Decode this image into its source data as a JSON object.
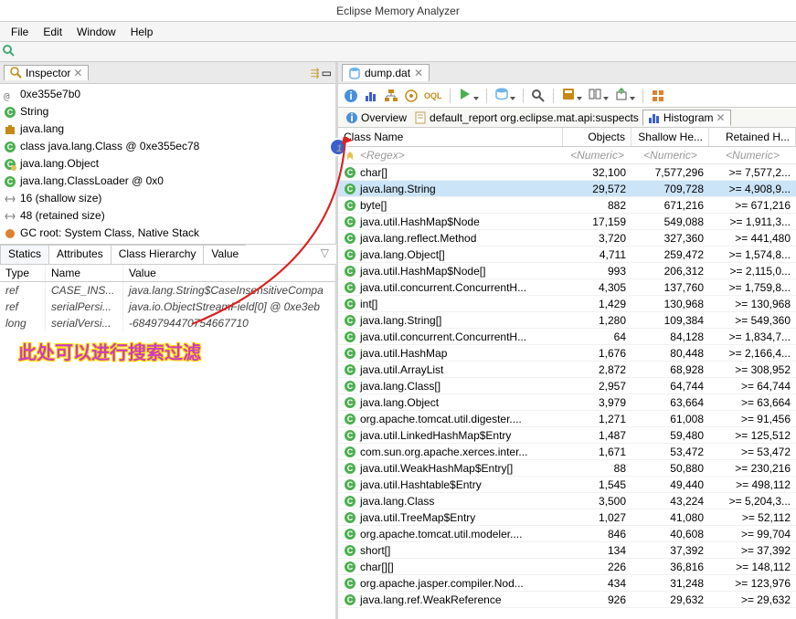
{
  "app_title": "Eclipse Memory Analyzer",
  "menus": [
    "File",
    "Edit",
    "Window",
    "Help"
  ],
  "inspector": {
    "tab": "Inspector",
    "rows": [
      {
        "icon": "at",
        "text": "0xe355e7b0"
      },
      {
        "icon": "class",
        "text": "String"
      },
      {
        "icon": "package",
        "text": "java.lang"
      },
      {
        "icon": "class",
        "text": "class java.lang.Class @ 0xe355ec78"
      },
      {
        "icon": "class-deco",
        "text": "java.lang.Object"
      },
      {
        "icon": "class",
        "text": "java.lang.ClassLoader @ 0x0"
      },
      {
        "icon": "size",
        "text": "16 (shallow size)"
      },
      {
        "icon": "size",
        "text": "48 (retained size)"
      },
      {
        "icon": "gc",
        "text": "GC root: System Class, Native Stack"
      }
    ],
    "subtabs": [
      "Statics",
      "Attributes",
      "Class Hierarchy",
      "Value"
    ],
    "columns": {
      "type": "Type",
      "name": "Name",
      "value": "Value"
    },
    "props": [
      {
        "type": "ref",
        "name": "CASE_INS...",
        "value": "java.lang.String$CaseInsensitiveCompa"
      },
      {
        "type": "ref",
        "name": "serialPersi...",
        "value": "java.io.ObjectStreamField[0] @ 0xe3eb"
      },
      {
        "type": "long",
        "name": "serialVersi...",
        "value": "-6849794470754667710"
      }
    ]
  },
  "annotation": "此处可以进行搜索过滤",
  "editor": {
    "file": "dump.dat"
  },
  "nav": {
    "overview": "Overview",
    "report": "default_report  org.eclipse.mat.api:suspects",
    "histogram": "Histogram"
  },
  "hist": {
    "cols": {
      "cn": "Class Name",
      "ob": "Objects",
      "sh": "Shallow He...",
      "rh": "Retained H..."
    },
    "filter": {
      "cn": "<Regex>",
      "n": "<Numeric>"
    },
    "badge": "1",
    "rows": [
      {
        "cn": "char[]",
        "ob": "32,100",
        "sh": "7,577,296",
        "rh": ">= 7,577,2..."
      },
      {
        "cn": "java.lang.String",
        "ob": "29,572",
        "sh": "709,728",
        "rh": ">= 4,908,9...",
        "sel": true
      },
      {
        "cn": "byte[]",
        "ob": "882",
        "sh": "671,216",
        "rh": ">= 671,216"
      },
      {
        "cn": "java.util.HashMap$Node",
        "ob": "17,159",
        "sh": "549,088",
        "rh": ">= 1,911,3..."
      },
      {
        "cn": "java.lang.reflect.Method",
        "ob": "3,720",
        "sh": "327,360",
        "rh": ">= 441,480"
      },
      {
        "cn": "java.lang.Object[]",
        "ob": "4,711",
        "sh": "259,472",
        "rh": ">= 1,574,8..."
      },
      {
        "cn": "java.util.HashMap$Node[]",
        "ob": "993",
        "sh": "206,312",
        "rh": ">= 2,115,0..."
      },
      {
        "cn": "java.util.concurrent.ConcurrentH...",
        "ob": "4,305",
        "sh": "137,760",
        "rh": ">= 1,759,8..."
      },
      {
        "cn": "int[]",
        "ob": "1,429",
        "sh": "130,968",
        "rh": ">= 130,968"
      },
      {
        "cn": "java.lang.String[]",
        "ob": "1,280",
        "sh": "109,384",
        "rh": ">= 549,360"
      },
      {
        "cn": "java.util.concurrent.ConcurrentH...",
        "ob": "64",
        "sh": "84,128",
        "rh": ">= 1,834,7..."
      },
      {
        "cn": "java.util.HashMap",
        "ob": "1,676",
        "sh": "80,448",
        "rh": ">= 2,166,4..."
      },
      {
        "cn": "java.util.ArrayList",
        "ob": "2,872",
        "sh": "68,928",
        "rh": ">= 308,952"
      },
      {
        "cn": "java.lang.Class[]",
        "ob": "2,957",
        "sh": "64,744",
        "rh": ">= 64,744"
      },
      {
        "cn": "java.lang.Object",
        "ob": "3,979",
        "sh": "63,664",
        "rh": ">= 63,664"
      },
      {
        "cn": "org.apache.tomcat.util.digester....",
        "ob": "1,271",
        "sh": "61,008",
        "rh": ">= 91,456"
      },
      {
        "cn": "java.util.LinkedHashMap$Entry",
        "ob": "1,487",
        "sh": "59,480",
        "rh": ">= 125,512"
      },
      {
        "cn": "com.sun.org.apache.xerces.inter...",
        "ob": "1,671",
        "sh": "53,472",
        "rh": ">= 53,472"
      },
      {
        "cn": "java.util.WeakHashMap$Entry[]",
        "ob": "88",
        "sh": "50,880",
        "rh": ">= 230,216"
      },
      {
        "cn": "java.util.Hashtable$Entry",
        "ob": "1,545",
        "sh": "49,440",
        "rh": ">= 498,112"
      },
      {
        "cn": "java.lang.Class",
        "ob": "3,500",
        "sh": "43,224",
        "rh": ">= 5,204,3..."
      },
      {
        "cn": "java.util.TreeMap$Entry",
        "ob": "1,027",
        "sh": "41,080",
        "rh": ">= 52,112"
      },
      {
        "cn": "org.apache.tomcat.util.modeler....",
        "ob": "846",
        "sh": "40,608",
        "rh": ">= 99,704"
      },
      {
        "cn": "short[]",
        "ob": "134",
        "sh": "37,392",
        "rh": ">= 37,392"
      },
      {
        "cn": "char[][]",
        "ob": "226",
        "sh": "36,816",
        "rh": ">= 148,112"
      },
      {
        "cn": "org.apache.jasper.compiler.Nod...",
        "ob": "434",
        "sh": "31,248",
        "rh": ">= 123,976"
      },
      {
        "cn": "java.lang.ref.WeakReference",
        "ob": "926",
        "sh": "29,632",
        "rh": ">= 29,632"
      }
    ]
  }
}
